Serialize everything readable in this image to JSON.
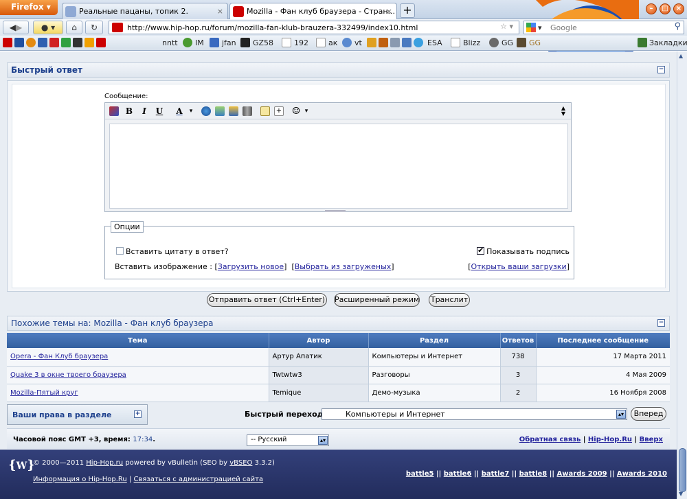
{
  "browser": {
    "menu_button": "Firefox",
    "tabs": [
      {
        "title": "Реальные пацаны, топик 2.",
        "active": false
      },
      {
        "title": "Mozilla - Фан клуб браузера - Стран...",
        "active": true
      }
    ],
    "tab_close": "×",
    "new_tab": "+",
    "url": "http://www.hip-hop.ru/forum/mozilla-fan-klub-brauzera-332499/index10.html",
    "search_placeholder": "Google",
    "bookmarks": [
      "nntt",
      "IM",
      "jfan",
      "GZ58",
      "192",
      "ак",
      "vt",
      "ESA",
      "Blizz",
      "GG",
      "GG"
    ],
    "bookmarks_menu": "Закладки"
  },
  "quick_reply": {
    "title": "Быстрый ответ",
    "message_label": "Сообщение:",
    "toolbar": {
      "bold": "B",
      "italic": "I",
      "underline": "U",
      "color": "A"
    },
    "message_value": "",
    "options": {
      "legend": "Опции",
      "quote_label": "Вставить цитату в ответ?",
      "quote_checked": false,
      "signature_label": "Показывать подпись",
      "signature_checked": true,
      "insert_image_label": "Вставить изображение :",
      "upload_new": "Загрузить новое",
      "choose_uploaded": "Выбрать из загруженых",
      "open_uploads": "Открыть ваши загрузки"
    },
    "buttons": {
      "submit": "Отправить ответ (Ctrl+Enter)",
      "advanced": "Расширенный режим",
      "translit": "Транслит"
    }
  },
  "similar": {
    "title": "Похожие темы на: Mozilla - Фан клуб браузера",
    "columns": [
      "Тема",
      "Автор",
      "Раздел",
      "Ответов",
      "Последнее сообщение"
    ],
    "rows": [
      {
        "topic": "Opera - Фан Клуб браузера",
        "author": "Артур Апатик",
        "section": "Компьютеры и Интернет",
        "replies": "738",
        "last": "17 Марта 2011"
      },
      {
        "topic": "Quake 3 в окне твоего браузера",
        "author": "Twtwtw3",
        "section": "Разговоры",
        "replies": "3",
        "last": "4 Мая 2009"
      },
      {
        "topic": "Mozilla-Пятый круг",
        "author": "Temique",
        "section": "Демо-музыка",
        "replies": "2",
        "last": "16 Ноября 2008"
      }
    ]
  },
  "rights": {
    "label": "Ваши права в разделе"
  },
  "quick_nav": {
    "label": "Быстрый переход",
    "selected": "Компьютеры и Интернет",
    "go": "Вперед"
  },
  "footer": {
    "tz_text": "Часовой пояс GMT +3, время:",
    "time": "17:34",
    "language": "-- Русский",
    "links": [
      "Обратная связь",
      "Hip-Hop.Ru",
      "Вверх"
    ]
  },
  "bottom": {
    "copyright_pre": "© 2000—2011",
    "site": "Hip-Hop.ru",
    "powered": "powered by vBulletin (SEO by",
    "vbseo": "vBSEO",
    "version": "3.3.2)",
    "info_link": "Информация о Hip-Hop.Ru",
    "contact_link": "Связаться с администрацией сайта",
    "right_links": [
      "battle5",
      "battle6",
      "battle7",
      "battle8",
      "Awards 2009",
      "Awards 2010"
    ]
  }
}
